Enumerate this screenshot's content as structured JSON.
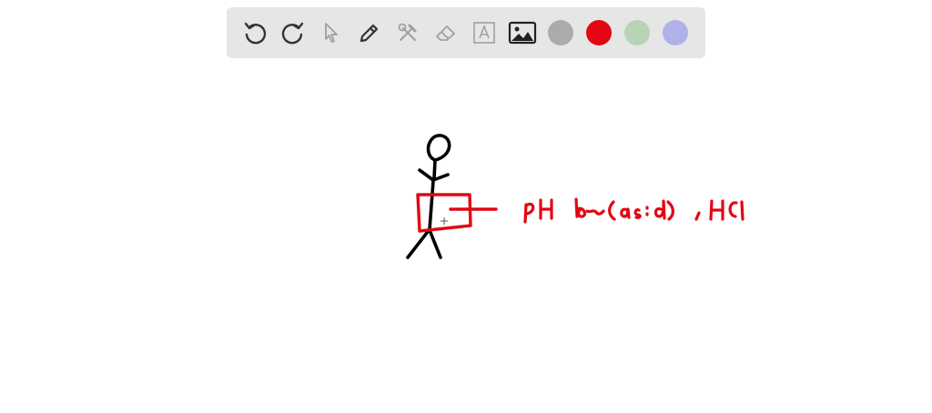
{
  "toolbar": {
    "tools": [
      {
        "icon": "undo-icon"
      },
      {
        "icon": "redo-icon"
      },
      {
        "icon": "select-cursor-icon"
      },
      {
        "icon": "pen-icon"
      },
      {
        "icon": "tools-icon"
      },
      {
        "icon": "eraser-icon"
      },
      {
        "icon": "text-box-icon"
      },
      {
        "icon": "image-icon"
      }
    ],
    "colors": [
      "#ababab",
      "#e30613",
      "#b7d4b7",
      "#b1b1ea"
    ]
  },
  "ink_colors": {
    "figure": "#000000",
    "annotation": "#e30613"
  }
}
